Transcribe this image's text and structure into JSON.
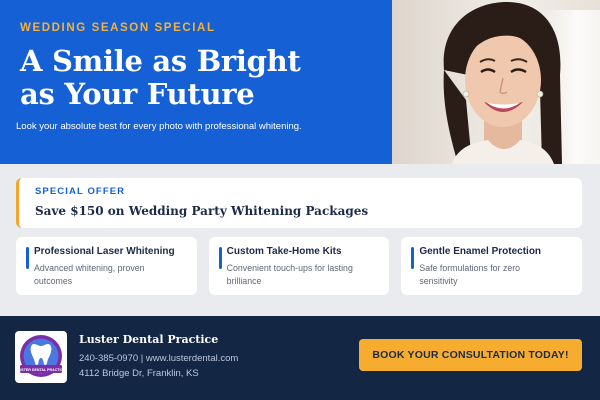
{
  "hero": {
    "eyebrow": "WEDDING SEASON SPECIAL",
    "headline_line1": "A Smile as Bright",
    "headline_line2": "as Your Future",
    "subline": "Look your absolute best for every photo with professional whitening.",
    "photo_icon": "bride-portrait-photo"
  },
  "offer": {
    "tag": "SPECIAL OFFER",
    "title": "Save $150 on Wedding Party Whitening Packages",
    "accent_color": "#f3a52c"
  },
  "features": [
    {
      "title": "Professional Laser Whitening",
      "desc_line1": "Advanced whitening, proven",
      "desc_line2": "outcomes"
    },
    {
      "title": "Custom Take-Home Kits",
      "desc_line1": "Convenient touch-ups for lasting",
      "desc_line2": "brilliance"
    },
    {
      "title": "Gentle Enamel Protection",
      "desc_line1": "Safe formulations for zero",
      "desc_line2": "sensitivity"
    }
  ],
  "footer": {
    "logo_icon": "tooth-logo-icon",
    "logo_text": "LUSTER DENTAL PRACTICE",
    "practice_name": "Luster Dental Practice",
    "contact_line1": "240-385-0970 | www.lusterdental.com",
    "contact_line2": "4112 Bridge Dr, Franklin, KS",
    "cta_label": "BOOK YOUR CONSULTATION TODAY!"
  },
  "colors": {
    "brand_blue": "#1560d4",
    "navy": "#132744",
    "accent_orange": "#f6ac2f",
    "gold_text": "#f3b23c"
  }
}
